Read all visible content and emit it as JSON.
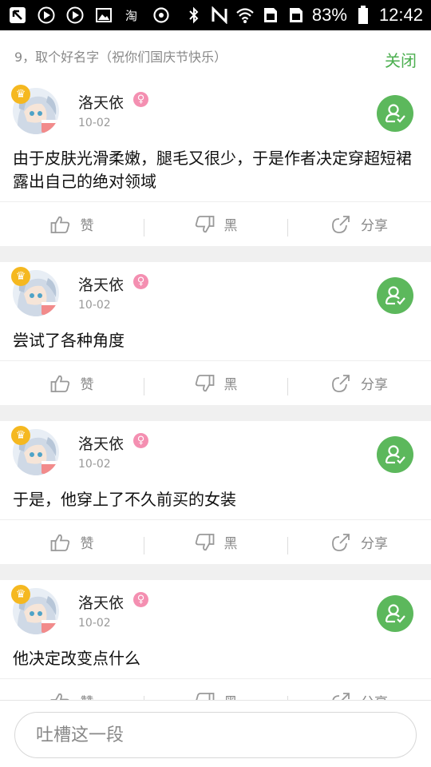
{
  "status_bar": {
    "battery": "83%",
    "time": "12:42",
    "icons": [
      "back-arrow-icon",
      "play-icon",
      "play-icon",
      "image-icon",
      "taobao-icon",
      "sync-icon",
      "bluetooth-icon",
      "nfc-icon",
      "wifi-icon",
      "sim-card-icon",
      "sim-card-icon",
      "battery-icon"
    ]
  },
  "header": {
    "title": "9，取个好名字（祝你们国庆节快乐）",
    "close_label": "关闭"
  },
  "posts": [
    {
      "username": "洛天依",
      "date": "10-02",
      "content": "由于皮肤光滑柔嫩，腿毛又很少，于是作者决定穿超短裙露出自己的绝对领域"
    },
    {
      "username": "洛天依",
      "date": "10-02",
      "content": "尝试了各种角度"
    },
    {
      "username": "洛天依",
      "date": "10-02",
      "content": "于是，他穿上了不久前买的女装"
    },
    {
      "username": "洛天依",
      "date": "10-02",
      "content": "他决定改变点什么"
    }
  ],
  "actions": {
    "like": "赞",
    "dislike": "黑",
    "share": "分享"
  },
  "comment": {
    "placeholder": "吐槽这一段"
  },
  "colors": {
    "accent_green": "#4caf50",
    "follow_green": "#5cb85c",
    "gender_pink": "#f48fb1",
    "crown_gold": "#f5b820"
  }
}
